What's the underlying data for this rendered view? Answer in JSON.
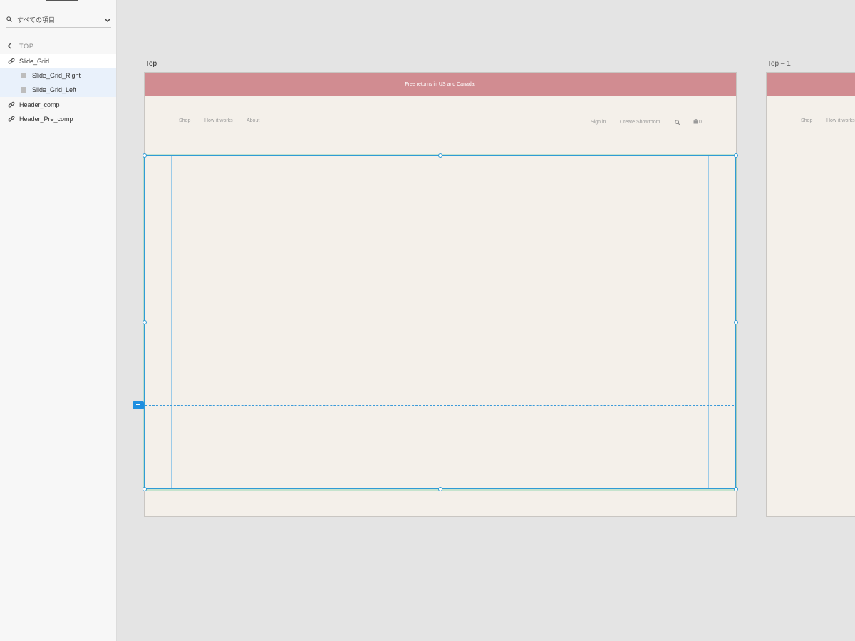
{
  "panel": {
    "search_label": "すべての項目",
    "back_label": "TOP",
    "layers": [
      {
        "label": "Slide_Grid",
        "type": "component"
      },
      {
        "label": "Slide_Grid_Right",
        "type": "rectangle"
      },
      {
        "label": "Slide_Grid_Left",
        "type": "rectangle"
      },
      {
        "label": "Header_comp",
        "type": "component"
      },
      {
        "label": "Header_Pre_comp",
        "type": "component"
      }
    ]
  },
  "artboards": {
    "main": {
      "title": "Top",
      "promo_text": "Free returns in US and Canada!",
      "nav_left": [
        "Shop",
        "How it works",
        "About"
      ],
      "nav_right": [
        "Sign in",
        "Create Showroom"
      ],
      "cart_count": "0"
    },
    "secondary": {
      "title": "Top – 1",
      "nav_left": [
        "Shop",
        "How it works"
      ]
    }
  },
  "colors": {
    "promo_bar": "#d18c91",
    "artboard_bg": "#f4f0ea",
    "selection": "#2f9bd6",
    "canvas": "#e4e4e4"
  }
}
